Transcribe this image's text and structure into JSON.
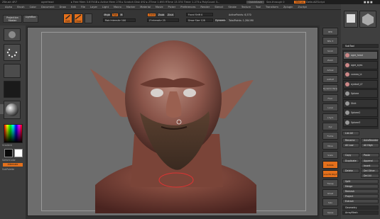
{
  "titlebar": {
    "app": "ZBrush 4R7",
    "doc": "ogreHead",
    "mem": "▸ Free Mem 3.675GB ▸ Active Mem 278 ▸ Scratch Disk 492 ▸ ZTime 1.693 RTime 13.374 Timer 1.273 ▸ PolyCount 3...",
    "quicksave": "QuickSave",
    "seethrough": "See-through 0",
    "menus": "Menus",
    "defaultscript": "DefaultZScript"
  },
  "menu_items": [
    "Alpha",
    "Brush",
    "Color",
    "Document",
    "Draw",
    "Edit",
    "File",
    "Layer",
    "Light",
    "Macro",
    "Marker",
    "Material",
    "Movie",
    "Picker",
    "Preferences",
    "Render",
    "Stencil",
    "Stroke",
    "Texture",
    "Tool",
    "Transform",
    "Zplugin",
    "Zscript"
  ],
  "left_tray": {
    "projection_master": "Projection Master",
    "lightbox": "LightBox",
    "gradient": "Gradient",
    "switch_color": "SwitchColor",
    "alternate": "Alternate",
    "subpalette": "SubPalette",
    "primary_color": "#0a0a0a",
    "secondary_color": "#ffffff"
  },
  "toolbar": {
    "edit": "Edit",
    "draw": "Draw",
    "mrgb": "Mrgb",
    "rgb": "Rgb",
    "m": "M",
    "zadd": "Zadd",
    "zsub": "Zsub",
    "zcut": "Zcut",
    "rgb_intensity": "Rgb Intensity 100",
    "z_intensity": "Z Intensity 25",
    "focal_shift": "Focal Shift 0",
    "draw_size": "Draw Size 128",
    "dynamic": "Dynamic",
    "active_points": "ActivePoints: 6,570",
    "total_points": "TotalPoints: 1.284 Mil"
  },
  "canvas": {
    "bg_color": "#6d6d6d"
  },
  "right_shelf": {
    "buttons": [
      "BPR",
      "SPix 3",
      "Scroll",
      "Zoom",
      "Actual",
      "AAHalf",
      "Dynamic Persp",
      "Floor",
      "Local",
      "L.Sym",
      "Xyz",
      "Frame",
      "Move",
      "Scale",
      "Rotate",
      "Line Fill PolyF",
      "Transp",
      "Ghost",
      "Solo",
      "Xpose"
    ]
  },
  "tool_panel": {
    "header": "SubTool",
    "subtools": [
      "ogre_head",
      "ogre_eyes",
      "cornea_Lt",
      "eyeball_LT",
      "Sphere",
      "Shirt",
      "Sphere2",
      "Sphere3"
    ],
    "buttons": {
      "list_all": "List All",
      "rename": "Rename",
      "auto_reorder": "AutoReorder",
      "all_low": "All Low",
      "all_high": "All High",
      "copy": "Copy",
      "paste": "Paste",
      "duplicate": "Duplicate",
      "append": "Append",
      "insert": "Insert",
      "delete": "Delete",
      "del_other": "Del Other",
      "del_all": "Del All",
      "split": "Split",
      "merge": "Merge",
      "remesh": "Remesh",
      "project": "Project",
      "extract": "Extract",
      "geometry": "Geometry",
      "arraymesh": "ArrayMesh"
    }
  },
  "accent": "#e3701c"
}
